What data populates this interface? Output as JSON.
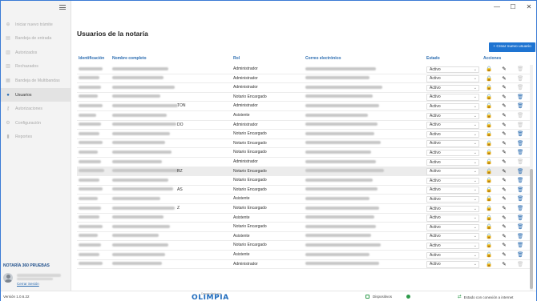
{
  "window": {
    "minimize": "—",
    "maximize": "☐",
    "close": "✕"
  },
  "sidebar": {
    "items": [
      {
        "label": "Iniciar nuevo trámite",
        "icon": "plus-circle-icon",
        "glyph": "⊕",
        "active": false
      },
      {
        "label": "Bandeja de entrada",
        "icon": "inbox-icon",
        "glyph": "▤",
        "active": false
      },
      {
        "label": "Autorizados",
        "icon": "document-check-icon",
        "glyph": "▥",
        "active": false
      },
      {
        "label": "Rechazados",
        "icon": "document-x-icon",
        "glyph": "▥",
        "active": false
      },
      {
        "label": "Bandeja de Multibandas",
        "icon": "multi-inbox-icon",
        "glyph": "▦",
        "active": false
      },
      {
        "label": "Usuarios",
        "icon": "user-icon",
        "glyph": "●",
        "active": true
      },
      {
        "label": "Autorizaciones",
        "icon": "key-icon",
        "glyph": "⚷",
        "active": false
      },
      {
        "label": "Configuración",
        "icon": "gear-icon",
        "glyph": "⚙",
        "active": false
      },
      {
        "label": "Reportes",
        "icon": "bar-chart-icon",
        "glyph": "▮",
        "active": false
      }
    ],
    "notary_name": "NOTARÍA 360 PRUEBAS",
    "close_session": "Cerrar Sesión"
  },
  "main": {
    "title": "Usuarios de la notaría",
    "create_button": "+ Crear nuevo usuario",
    "columns": [
      "Identificación",
      "Nombre completo",
      "Rol",
      "Correo electrónico",
      "Estado",
      "Acciones"
    ],
    "rows": [
      {
        "role": "Administrador",
        "status": "Activo",
        "name_suffix": "",
        "trash_enabled": false,
        "highlight": false
      },
      {
        "role": "Administrador",
        "status": "Activo",
        "name_suffix": "",
        "trash_enabled": false,
        "highlight": false
      },
      {
        "role": "Administrador",
        "status": "Activo",
        "name_suffix": "",
        "trash_enabled": false,
        "highlight": false
      },
      {
        "role": "Notario Encargado",
        "status": "Activo",
        "name_suffix": "",
        "trash_enabled": true,
        "highlight": false
      },
      {
        "role": "Administrador",
        "status": "Activo",
        "name_suffix": "TON",
        "trash_enabled": true,
        "highlight": false
      },
      {
        "role": "Asistente",
        "status": "Activo",
        "name_suffix": "",
        "trash_enabled": false,
        "highlight": false
      },
      {
        "role": "Administrador",
        "status": "Activo",
        "name_suffix": "DO",
        "trash_enabled": false,
        "highlight": false
      },
      {
        "role": "Notario Encargado",
        "status": "Activo",
        "name_suffix": "",
        "trash_enabled": true,
        "highlight": false
      },
      {
        "role": "Notario Encargado",
        "status": "Activo",
        "name_suffix": "",
        "trash_enabled": true,
        "highlight": false
      },
      {
        "role": "Notario Encargado",
        "status": "Activo",
        "name_suffix": "",
        "trash_enabled": true,
        "highlight": false
      },
      {
        "role": "Administrador",
        "status": "Activo",
        "name_suffix": "",
        "trash_enabled": false,
        "highlight": false
      },
      {
        "role": "Notario Encargado",
        "status": "Activo",
        "name_suffix": "RZ",
        "trash_enabled": true,
        "highlight": true
      },
      {
        "role": "Notario Encargado",
        "status": "Activo",
        "name_suffix": "",
        "trash_enabled": true,
        "highlight": false
      },
      {
        "role": "Notario Encargado",
        "status": "Activo",
        "name_suffix": "AS",
        "trash_enabled": true,
        "highlight": false
      },
      {
        "role": "Asistente",
        "status": "Activo",
        "name_suffix": "",
        "trash_enabled": true,
        "highlight": false
      },
      {
        "role": "Notario Encargado",
        "status": "Activo",
        "name_suffix": "Z",
        "trash_enabled": true,
        "highlight": false
      },
      {
        "role": "Asistente",
        "status": "Activo",
        "name_suffix": "",
        "trash_enabled": true,
        "highlight": false
      },
      {
        "role": "Notario Encargado",
        "status": "Activo",
        "name_suffix": "",
        "trash_enabled": true,
        "highlight": false
      },
      {
        "role": "Asistente",
        "status": "Activo",
        "name_suffix": "",
        "trash_enabled": true,
        "highlight": false
      },
      {
        "role": "Notario Encargado",
        "status": "Activo",
        "name_suffix": "",
        "trash_enabled": true,
        "highlight": false
      },
      {
        "role": "Asistente",
        "status": "Activo",
        "name_suffix": "",
        "trash_enabled": true,
        "highlight": false
      },
      {
        "role": "Administrador",
        "status": "Activo",
        "name_suffix": "",
        "trash_enabled": false,
        "highlight": false
      }
    ]
  },
  "statusbar": {
    "version": "Versión 1.0.6.22",
    "developed_by": "Desarrollado por",
    "brand": "OLIMPIA",
    "devices_label": "Dispositivos",
    "connection_label": "Estado con conexión a internet"
  },
  "colors": {
    "accent": "#1e74d2",
    "header_text": "#2b6cb0",
    "ok_green": "#2e9a4b"
  }
}
